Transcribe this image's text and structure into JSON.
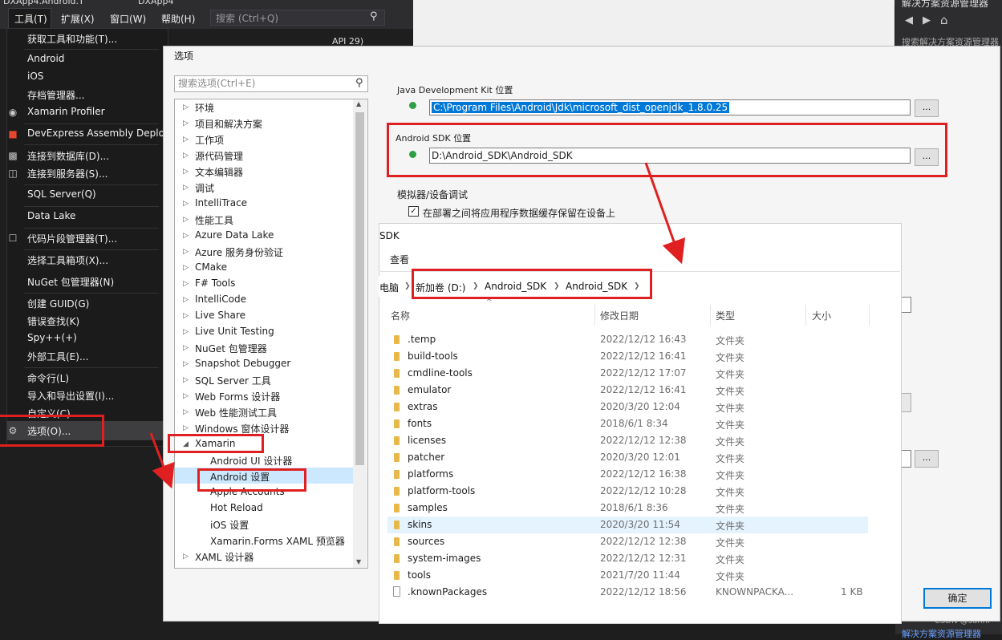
{
  "vs": {
    "titlebar_left": "DXApp4.Android.T",
    "titlebar_mid": "DXApp4",
    "menus": [
      "工具(T)",
      "扩展(X)",
      "窗口(W)",
      "帮助(H)"
    ],
    "search_placeholder": "搜索 (Ctrl+Q)",
    "api_label": "API 29)",
    "solution_title": "解决方案资源管理器",
    "solution_search": "搜索解决方案资源管理器",
    "solution_bottom": "解决方案资源管理器",
    "watermark": "CSDN @sunnf"
  },
  "tools_menu": [
    {
      "label": "获取工具和功能(T)...",
      "icon": ""
    },
    {
      "label": "Android",
      "icon": ""
    },
    {
      "label": "iOS",
      "icon": ""
    },
    {
      "label": "存档管理器...",
      "icon": ""
    },
    {
      "label": "Xamarin Profiler",
      "icon": "profiler-icon"
    },
    {
      "label": "DevExpress Assembly Deplo",
      "icon": "devexpress-icon"
    },
    {
      "label": "连接到数据库(D)...",
      "icon": "database-icon"
    },
    {
      "label": "连接到服务器(S)...",
      "icon": "server-icon"
    },
    {
      "label": "SQL Server(Q)",
      "icon": ""
    },
    {
      "label": "Data Lake",
      "icon": ""
    },
    {
      "label": "代码片段管理器(T)...",
      "icon": "snippet-icon"
    },
    {
      "label": "选择工具箱项(X)...",
      "icon": ""
    },
    {
      "label": "NuGet 包管理器(N)",
      "icon": ""
    },
    {
      "label": "创建 GUID(G)",
      "icon": ""
    },
    {
      "label": "错误查找(K)",
      "icon": ""
    },
    {
      "label": "Spy++(+)",
      "icon": ""
    },
    {
      "label": "外部工具(E)...",
      "icon": ""
    },
    {
      "label": "命令行(L)",
      "icon": ""
    },
    {
      "label": "导入和导出设置(I)...",
      "icon": ""
    },
    {
      "label": "自定义(C)...",
      "icon": ""
    },
    {
      "label": "选项(O)...",
      "icon": "gear-icon"
    }
  ],
  "options": {
    "title": "选项",
    "search_placeholder": "搜索选项(Ctrl+E)",
    "tree": [
      "环境",
      "项目和解决方案",
      "工作项",
      "源代码管理",
      "文本编辑器",
      "调试",
      "IntelliTrace",
      "性能工具",
      "Azure Data Lake",
      "Azure 服务身份验证",
      "CMake",
      "F# Tools",
      "IntelliCode",
      "Live Share",
      "Live Unit Testing",
      "NuGet 包管理器",
      "Snapshot Debugger",
      "SQL Server 工具",
      "Web Forms 设计器",
      "Web 性能测试工具",
      "Windows 窗体设计器"
    ],
    "xamarin": "Xamarin",
    "xamarin_children": [
      "Android UI 设计器",
      "Android 设置",
      "Apple Accounts",
      "Hot Reload",
      "iOS 设置",
      "Xamarin.Forms XAML 预览器"
    ],
    "tree_last": "XAML 设计器",
    "jdk_label": "Java Development Kit 位置",
    "jdk_path": "C:\\Program Files\\Android\\Jdk\\microsoft_dist_openjdk_1.8.0.25",
    "sdk_label": "Android SDK 位置",
    "sdk_path": "D:\\Android_SDK\\Android_SDK",
    "browse": "...",
    "emulator_section": "模拟器/设备调试",
    "cache_checkbox": "在部署之间将应用程序数据缓存保留在设备上",
    "ok": "确定"
  },
  "explorer": {
    "title": "SDK",
    "view": "查看",
    "crumbs": [
      "电脑",
      "新加卷 (D:)",
      "Android_SDK",
      "Android_SDK"
    ],
    "columns": [
      "名称",
      "修改日期",
      "类型",
      "大小"
    ],
    "files": [
      {
        "name": ".temp",
        "date": "2022/12/12 16:43",
        "type": "文件夹",
        "size": "",
        "kind": "folder"
      },
      {
        "name": "build-tools",
        "date": "2022/12/12 16:41",
        "type": "文件夹",
        "size": "",
        "kind": "folder"
      },
      {
        "name": "cmdline-tools",
        "date": "2022/12/12 17:07",
        "type": "文件夹",
        "size": "",
        "kind": "folder"
      },
      {
        "name": "emulator",
        "date": "2022/12/12 16:41",
        "type": "文件夹",
        "size": "",
        "kind": "folder"
      },
      {
        "name": "extras",
        "date": "2020/3/20 12:04",
        "type": "文件夹",
        "size": "",
        "kind": "folder"
      },
      {
        "name": "fonts",
        "date": "2018/6/1 8:34",
        "type": "文件夹",
        "size": "",
        "kind": "folder"
      },
      {
        "name": "licenses",
        "date": "2022/12/12 12:38",
        "type": "文件夹",
        "size": "",
        "kind": "folder"
      },
      {
        "name": "patcher",
        "date": "2020/3/20 12:01",
        "type": "文件夹",
        "size": "",
        "kind": "folder"
      },
      {
        "name": "platforms",
        "date": "2022/12/12 16:38",
        "type": "文件夹",
        "size": "",
        "kind": "folder"
      },
      {
        "name": "platform-tools",
        "date": "2022/12/12 10:28",
        "type": "文件夹",
        "size": "",
        "kind": "folder"
      },
      {
        "name": "samples",
        "date": "2018/6/1 8:36",
        "type": "文件夹",
        "size": "",
        "kind": "folder"
      },
      {
        "name": "skins",
        "date": "2020/3/20 11:54",
        "type": "文件夹",
        "size": "",
        "kind": "folder"
      },
      {
        "name": "sources",
        "date": "2022/12/12 12:38",
        "type": "文件夹",
        "size": "",
        "kind": "folder"
      },
      {
        "name": "system-images",
        "date": "2022/12/12 12:31",
        "type": "文件夹",
        "size": "",
        "kind": "folder"
      },
      {
        "name": "tools",
        "date": "2021/7/20 11:44",
        "type": "文件夹",
        "size": "",
        "kind": "folder"
      },
      {
        "name": ".knownPackages",
        "date": "2022/12/12 18:56",
        "type": "KNOWNPACKA...",
        "size": "1 KB",
        "kind": "file"
      }
    ]
  },
  "colors": {
    "highlight": "#e02020",
    "accent": "#0078d7"
  }
}
